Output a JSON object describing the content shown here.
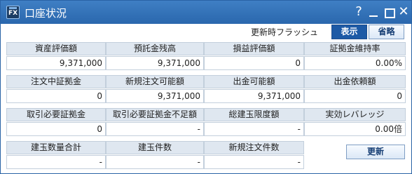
{
  "window": {
    "icon_text": "FX",
    "title": "口座状況",
    "help_label": "?"
  },
  "flash": {
    "label": "更新時フラッシュ",
    "on_label": "表示",
    "off_label": "省略"
  },
  "rows": [
    [
      {
        "label": "資産評価額",
        "value": "9,371,000"
      },
      {
        "label": "預託金残高",
        "value": "9,371,000"
      },
      {
        "label": "損益評価額",
        "value": "0"
      },
      {
        "label": "証拠金維持率",
        "value": "0.00%"
      }
    ],
    [
      {
        "label": "注文中証拠金",
        "value": "0"
      },
      {
        "label": "新規注文可能額",
        "value": "9,371,000"
      },
      {
        "label": "出金可能額",
        "value": "9,371,000"
      },
      {
        "label": "出金依頼額",
        "value": "0"
      }
    ],
    [
      {
        "label": "取引必要証拠金",
        "value": "0"
      },
      {
        "label": "取引必要証拠金不足額",
        "value": "-"
      },
      {
        "label": "総建玉限度額",
        "value": "-"
      },
      {
        "label": "実効レバレッジ",
        "value": "0.00倍"
      }
    ],
    [
      {
        "label": "建玉数量合計",
        "value": "-"
      },
      {
        "label": "建玉件数",
        "value": "-"
      },
      {
        "label": "新規注文件数",
        "value": "-"
      }
    ]
  ],
  "refresh_label": "更新"
}
